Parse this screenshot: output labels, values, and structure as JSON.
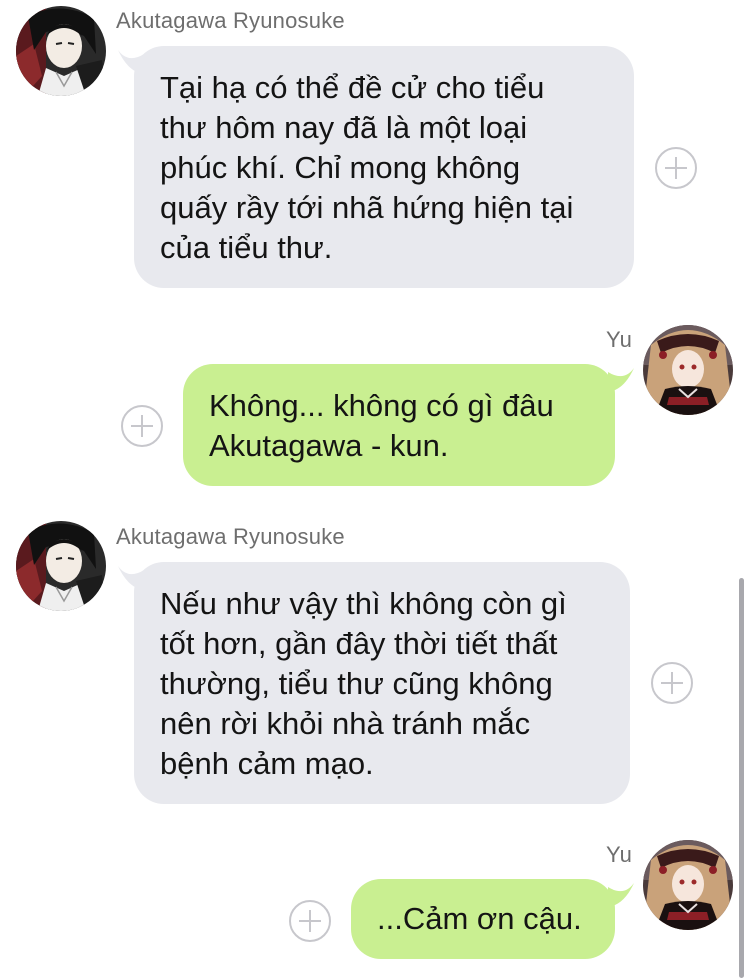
{
  "messages": [
    {
      "direction": "incoming",
      "sender": "Akutagawa Ryunosuke",
      "text": "Tại hạ có thể đề cử cho tiểu\nthư hôm nay đã là một loại\nphúc khí. Chỉ mong không\nquấy rầy tới nhã hứng hiện tại\ncủa tiểu thư."
    },
    {
      "direction": "outgoing",
      "sender": "Yu",
      "text": "Không... không có gì đâu\nAkutagawa - kun."
    },
    {
      "direction": "incoming",
      "sender": "Akutagawa Ryunosuke",
      "text": "Nếu như vậy thì không còn gì\ntốt hơn, gần đây thời tiết thất\nthường, tiểu thư cũng không\nnên rời khỏi nhà tránh mắc\nbệnh cảm mạo."
    },
    {
      "direction": "outgoing",
      "sender": "Yu",
      "text": "...Cảm ơn cậu."
    }
  ],
  "colors": {
    "incoming_bubble": "#e8e9ee",
    "outgoing_bubble": "#c9ef91",
    "name_text": "#6e6e6e",
    "plus_icon": "#c7c7cc"
  },
  "icons": {
    "reaction": "circle-plus-icon",
    "avatar_akutagawa": "avatar-akutagawa",
    "avatar_yu": "avatar-yu"
  }
}
